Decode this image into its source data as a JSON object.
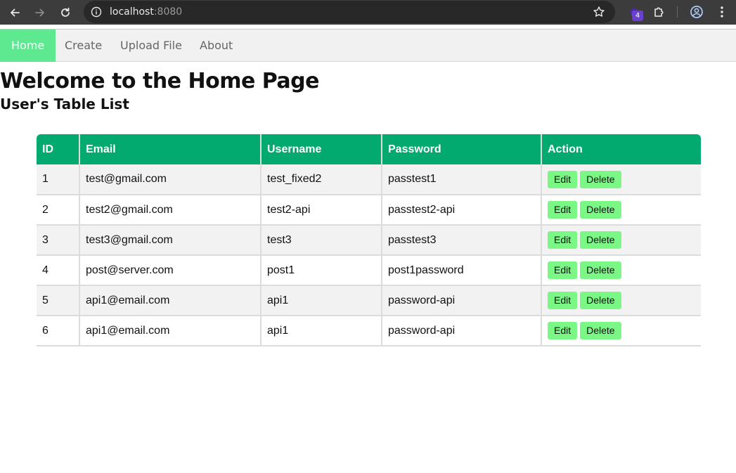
{
  "browser": {
    "url_host": "localhost",
    "url_port": ":8080",
    "extension_badge": "4"
  },
  "nav": {
    "items": [
      {
        "label": "Home",
        "active": true
      },
      {
        "label": "Create",
        "active": false
      },
      {
        "label": "Upload File",
        "active": false
      },
      {
        "label": "About",
        "active": false
      }
    ],
    "active_color": "#5ee88f"
  },
  "page": {
    "title": "Welcome to the Home Page",
    "subtitle": "User's Table List"
  },
  "table": {
    "header_color": "#03aa6f",
    "columns": [
      "ID",
      "Email",
      "Username",
      "Password",
      "Action"
    ],
    "rows": [
      {
        "id": "1",
        "email": "test@gmail.com",
        "username": "test_fixed2",
        "password": "passtest1"
      },
      {
        "id": "2",
        "email": "test2@gmail.com",
        "username": "test2-api",
        "password": "passtest2-api"
      },
      {
        "id": "3",
        "email": "test3@gmail.com",
        "username": "test3",
        "password": "passtest3"
      },
      {
        "id": "4",
        "email": "post@server.com",
        "username": "post1",
        "password": "post1password"
      },
      {
        "id": "5",
        "email": "api1@email.com",
        "username": "api1",
        "password": "password-api"
      },
      {
        "id": "6",
        "email": "api1@email.com",
        "username": "api1",
        "password": "password-api"
      }
    ],
    "edit_label": "Edit",
    "delete_label": "Delete",
    "button_color": "#7bf786"
  }
}
